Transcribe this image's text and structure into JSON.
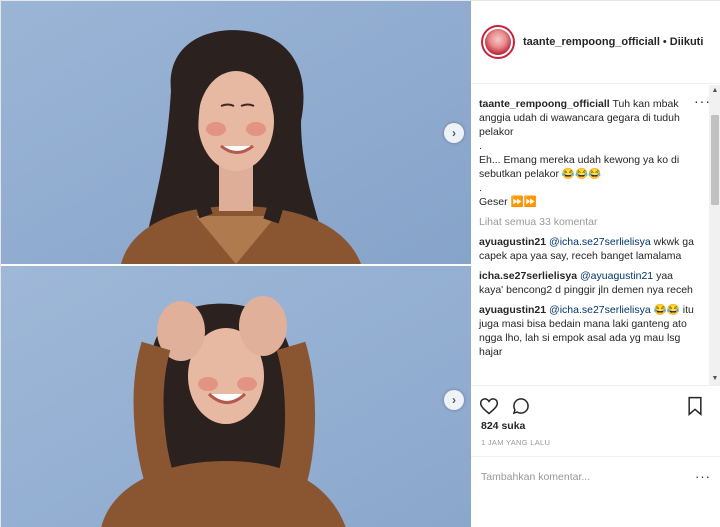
{
  "post": {
    "username": "taante_rempoong_officiall",
    "separator": "•",
    "follow_status": "Diikuti",
    "caption": {
      "author": "taante_rempoong_officiall",
      "line1": "Tuh kan mbak anggia udah di wawancara gegara di tuduh pelakor",
      "dot1": ".",
      "line2": "Eh... Emang mereka udah kewong ya ko di sebutkan pelakor 😂😂😂",
      "dot2": ".",
      "line3": "Geser ⏩⏩"
    },
    "view_all_comments": "Lihat semua 33 komentar",
    "comments": [
      {
        "user": "ayuagustin21",
        "mention": "@icha.se27serlielisya",
        "text": " wkwk ga capek apa yaa say, receh banget lamalama"
      },
      {
        "user": "icha.se27serlielisya",
        "mention": "@ayuagustin21",
        "text": " yaa kaya' bencong2 d pinggir jln demen nya receh"
      },
      {
        "user": "ayuagustin21",
        "mention": "@icha.se27serlielisya",
        "text": " 😂😂 itu juga masi bisa bedain mana laki ganteng ato ngga lho, lah si empok asal ada yg mau lsg hajar"
      }
    ],
    "likes_count": "824",
    "likes_label": "suka",
    "time_ago": "1 JAM YANG LALU",
    "add_comment_placeholder": "Tambahkan komentar...",
    "more_icon": "more-horizontal-icon",
    "options_icon": "options-dots-icon"
  },
  "colors": {
    "wall_blue": "#93aed1",
    "jacket_brown": "#8a5632",
    "hair_dark": "#2b211e",
    "skin": "#e7b9a3",
    "avatar_ring": "#c8233c",
    "muted_text": "#999999"
  }
}
